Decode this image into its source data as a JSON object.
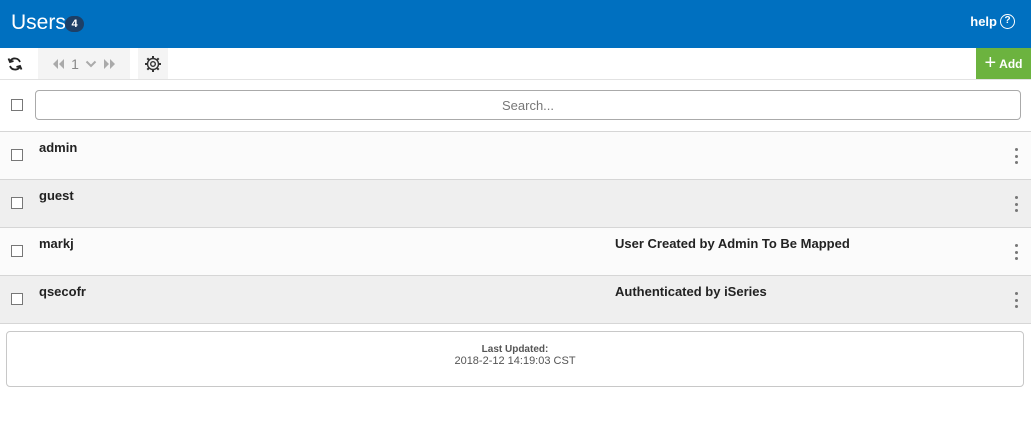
{
  "header": {
    "title": "Users",
    "count": "4",
    "help_label": "help",
    "help_icon": "?"
  },
  "toolbar": {
    "refresh_icon": "refresh-icon",
    "page_number": "1",
    "add_label": "Add",
    "add_icon": "+"
  },
  "search": {
    "placeholder": "Search...",
    "value": ""
  },
  "users": [
    {
      "name": "admin",
      "description": ""
    },
    {
      "name": "guest",
      "description": ""
    },
    {
      "name": "markj",
      "description": "User Created by Admin To Be Mapped"
    },
    {
      "name": "qsecofr",
      "description": "Authenticated by iSeries"
    }
  ],
  "footer": {
    "last_updated_label": "Last Updated:",
    "last_updated_value": "2018-2-12 14:19:03 CST"
  },
  "colors": {
    "header_bg": "#0070c0",
    "add_button_bg": "#6cb33f",
    "badge_bg": "#1d3f66"
  }
}
